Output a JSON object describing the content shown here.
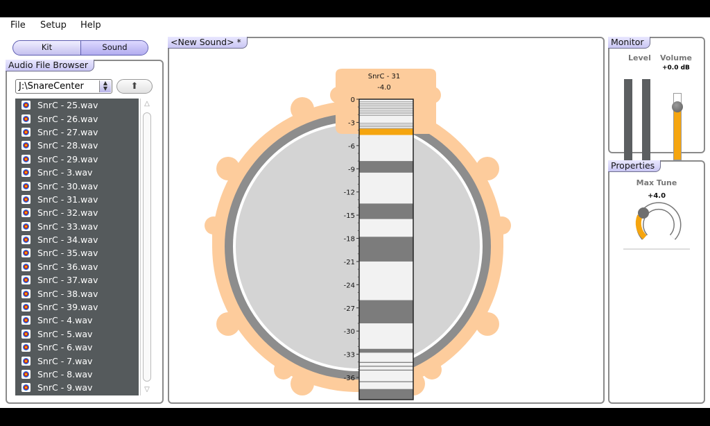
{
  "menu": [
    "File",
    "Setup",
    "Help"
  ],
  "mode_switch": {
    "left": "Kit",
    "right": "Sound",
    "active": "Sound"
  },
  "browser": {
    "title": "Audio File Browser",
    "path": "J:\\SnareCenter",
    "files": [
      "SnrC - 25.wav",
      "SnrC - 26.wav",
      "SnrC - 27.wav",
      "SnrC - 28.wav",
      "SnrC - 29.wav",
      "SnrC - 3.wav",
      "SnrC - 30.wav",
      "SnrC - 31.wav",
      "SnrC - 32.wav",
      "SnrC - 33.wav",
      "SnrC - 34.wav",
      "SnrC - 35.wav",
      "SnrC - 36.wav",
      "SnrC - 37.wav",
      "SnrC - 38.wav",
      "SnrC - 39.wav",
      "SnrC - 4.wav",
      "SnrC - 5.wav",
      "SnrC - 6.wav",
      "SnrC - 7.wav",
      "SnrC - 8.wav",
      "SnrC - 9.wav"
    ]
  },
  "sound": {
    "title": "<New Sound> *",
    "layer_name": "SnrC - 31",
    "layer_value": "-4.0",
    "scale_labels": [
      "0",
      "-3",
      "-6",
      "-9",
      "-12",
      "-15",
      "-18",
      "-21",
      "-24",
      "-27",
      "-30",
      "-33",
      "-36"
    ],
    "selected_level": -4.0,
    "colors": {
      "rim": "#fdcc9c",
      "head": "#d4d4d4",
      "accent": "#f5a50f"
    }
  },
  "monitor": {
    "title": "Monitor",
    "level_label": "Level",
    "volume_label": "Volume",
    "volume_value": "+0.0 dB"
  },
  "properties": {
    "title": "Properties",
    "knob_label": "Max Tune",
    "knob_value": "+4.0"
  }
}
